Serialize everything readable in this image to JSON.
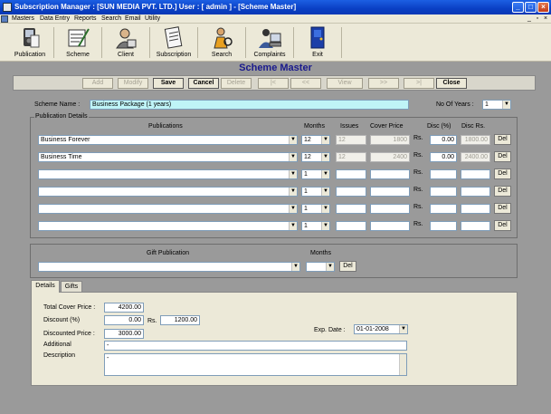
{
  "window": {
    "title": "Subscription Manager : [SUN MEDIA PVT. LTD.] User : [ admin ] - [Scheme Master]",
    "controls": [
      "_",
      "□",
      "×"
    ],
    "mdi_controls": [
      "_",
      "▫",
      "×"
    ]
  },
  "menu": [
    "Masters",
    "Data Entry",
    "Reports",
    "Search",
    "Email",
    "Utility"
  ],
  "toolbar": [
    {
      "label": "Publication",
      "icon": "publication-icon"
    },
    {
      "label": "Scheme",
      "icon": "scheme-icon"
    },
    {
      "label": "Client",
      "icon": "client-icon"
    },
    {
      "label": "Subscription",
      "icon": "subscription-icon"
    },
    {
      "label": "Search",
      "icon": "search-icon"
    },
    {
      "label": "Complaints",
      "icon": "complaints-icon"
    },
    {
      "label": "Exit",
      "icon": "exit-icon"
    }
  ],
  "heading": "Scheme Master",
  "nav_buttons": [
    {
      "label": "Add",
      "enabled": false
    },
    {
      "label": "Modify",
      "enabled": false
    },
    {
      "label": "Save",
      "enabled": true
    },
    {
      "label": "Cancel",
      "enabled": true
    },
    {
      "label": "Delete",
      "enabled": false
    },
    {
      "label": "|<",
      "enabled": false
    },
    {
      "label": "<<",
      "enabled": false
    },
    {
      "label": "View",
      "enabled": false
    },
    {
      "label": ">>",
      "enabled": false
    },
    {
      "label": ">|",
      "enabled": false
    },
    {
      "label": "Close",
      "enabled": true
    }
  ],
  "scheme": {
    "name_label": "Scheme Name :",
    "name_value": "Business Package (1 years)",
    "years_label": "No Of Years :",
    "years_value": "1"
  },
  "publication_details": {
    "caption": "Publication Details",
    "headers": {
      "publications": "Publications",
      "months": "Months",
      "issues": "Issues",
      "cover_price": "Cover Price",
      "disc_pct": "Disc (%)",
      "disc_rs": "Disc Rs."
    },
    "rs_label": "Rs.",
    "del_label": "Del",
    "rows": [
      {
        "publication": "Business Forever",
        "months": "12",
        "issues": "12",
        "cover_price": "1800",
        "disc_pct": "0.00",
        "disc_rs": "1800.00"
      },
      {
        "publication": "Business Time",
        "months": "12",
        "issues": "12",
        "cover_price": "2400",
        "disc_pct": "0.00",
        "disc_rs": "2400.00"
      },
      {
        "publication": "",
        "months": "1",
        "issues": "",
        "cover_price": "",
        "disc_pct": "",
        "disc_rs": ""
      },
      {
        "publication": "",
        "months": "1",
        "issues": "",
        "cover_price": "",
        "disc_pct": "",
        "disc_rs": ""
      },
      {
        "publication": "",
        "months": "1",
        "issues": "",
        "cover_price": "",
        "disc_pct": "",
        "disc_rs": ""
      },
      {
        "publication": "",
        "months": "1",
        "issues": "",
        "cover_price": "",
        "disc_pct": "",
        "disc_rs": ""
      }
    ]
  },
  "gift": {
    "publication_label": "Gift Publication",
    "months_label": "Months",
    "publication_value": "",
    "months_value": "",
    "del_label": "Del"
  },
  "tabs": [
    "Details",
    "Gifts"
  ],
  "details": {
    "total_cover_label": "Total Cover Price :",
    "total_cover_value": "4200.00",
    "discount_label": "Discount (%)",
    "discount_pct_value": "0.00",
    "discount_rs_label": "Rs.",
    "discount_rs_value": "1200.00",
    "discounted_label": "Discounted Price :",
    "discounted_value": "3000.00",
    "exp_date_label": "Exp. Date :",
    "exp_date_value": "01-01-2008",
    "additional_label": "Additional",
    "additional_value": "-",
    "description_label": "Description",
    "description_value": "-"
  }
}
